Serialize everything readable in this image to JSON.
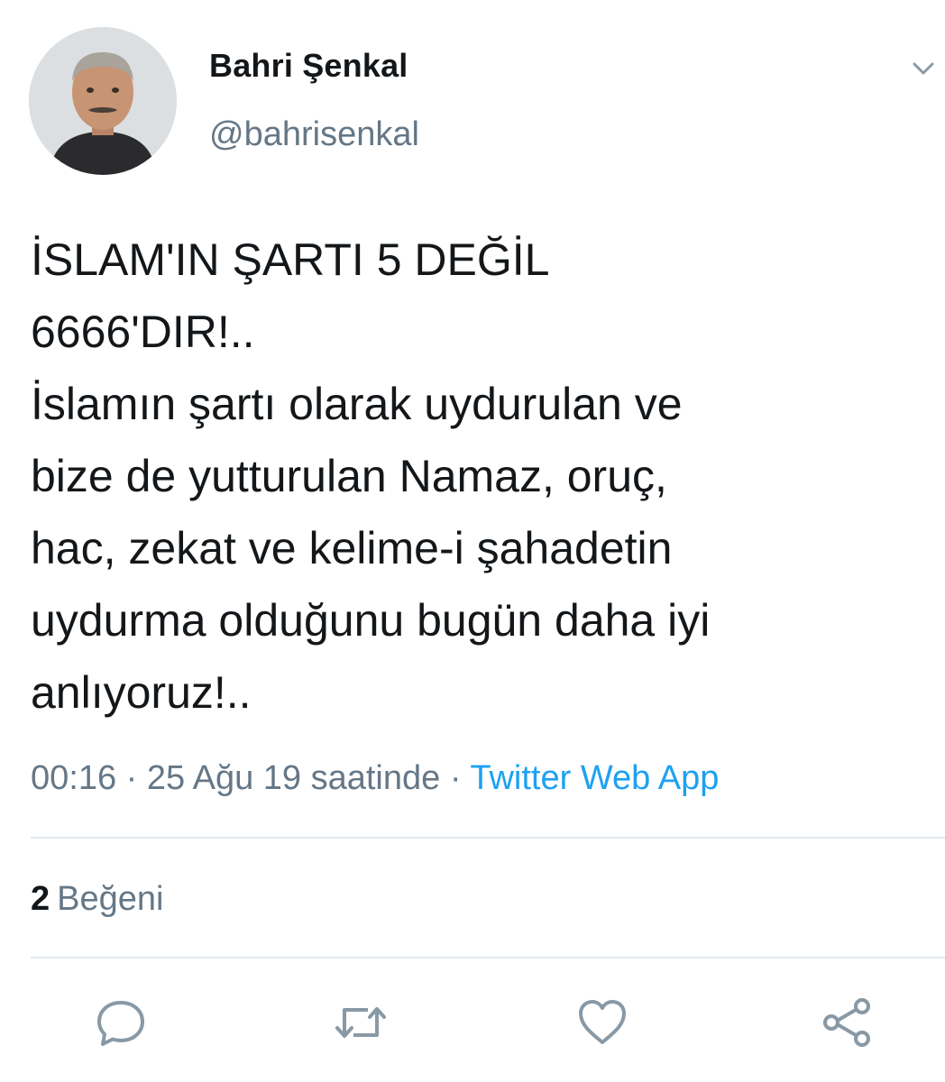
{
  "author": {
    "display_name": "Bahri Şenkal",
    "handle": "@bahrisenkal"
  },
  "tweet": {
    "text": "İSLAM'IN ŞARTI 5 DEĞİL\n6666'DIR!..\nİslamın şartı olarak uydurulan ve\nbize de yutturulan Namaz, oruç,\nhac, zekat ve kelime-i şahadetin\nuydurma olduğunu bugün daha iyi\nanlıyoruz!..",
    "time": "00:16",
    "separator": "·",
    "date": "25 Ağu 19 saatinde",
    "source": "Twitter Web App"
  },
  "stats": {
    "likes_count": "2",
    "likes_label": "Beğeni"
  },
  "icons": {
    "caret": "chevron-down-icon",
    "reply": "reply-icon",
    "retweet": "retweet-icon",
    "like": "heart-icon",
    "share": "share-icon"
  },
  "colors": {
    "text": "#14171a",
    "secondary": "#657786",
    "link": "#1da1f2",
    "divider": "#e1e8ed"
  }
}
